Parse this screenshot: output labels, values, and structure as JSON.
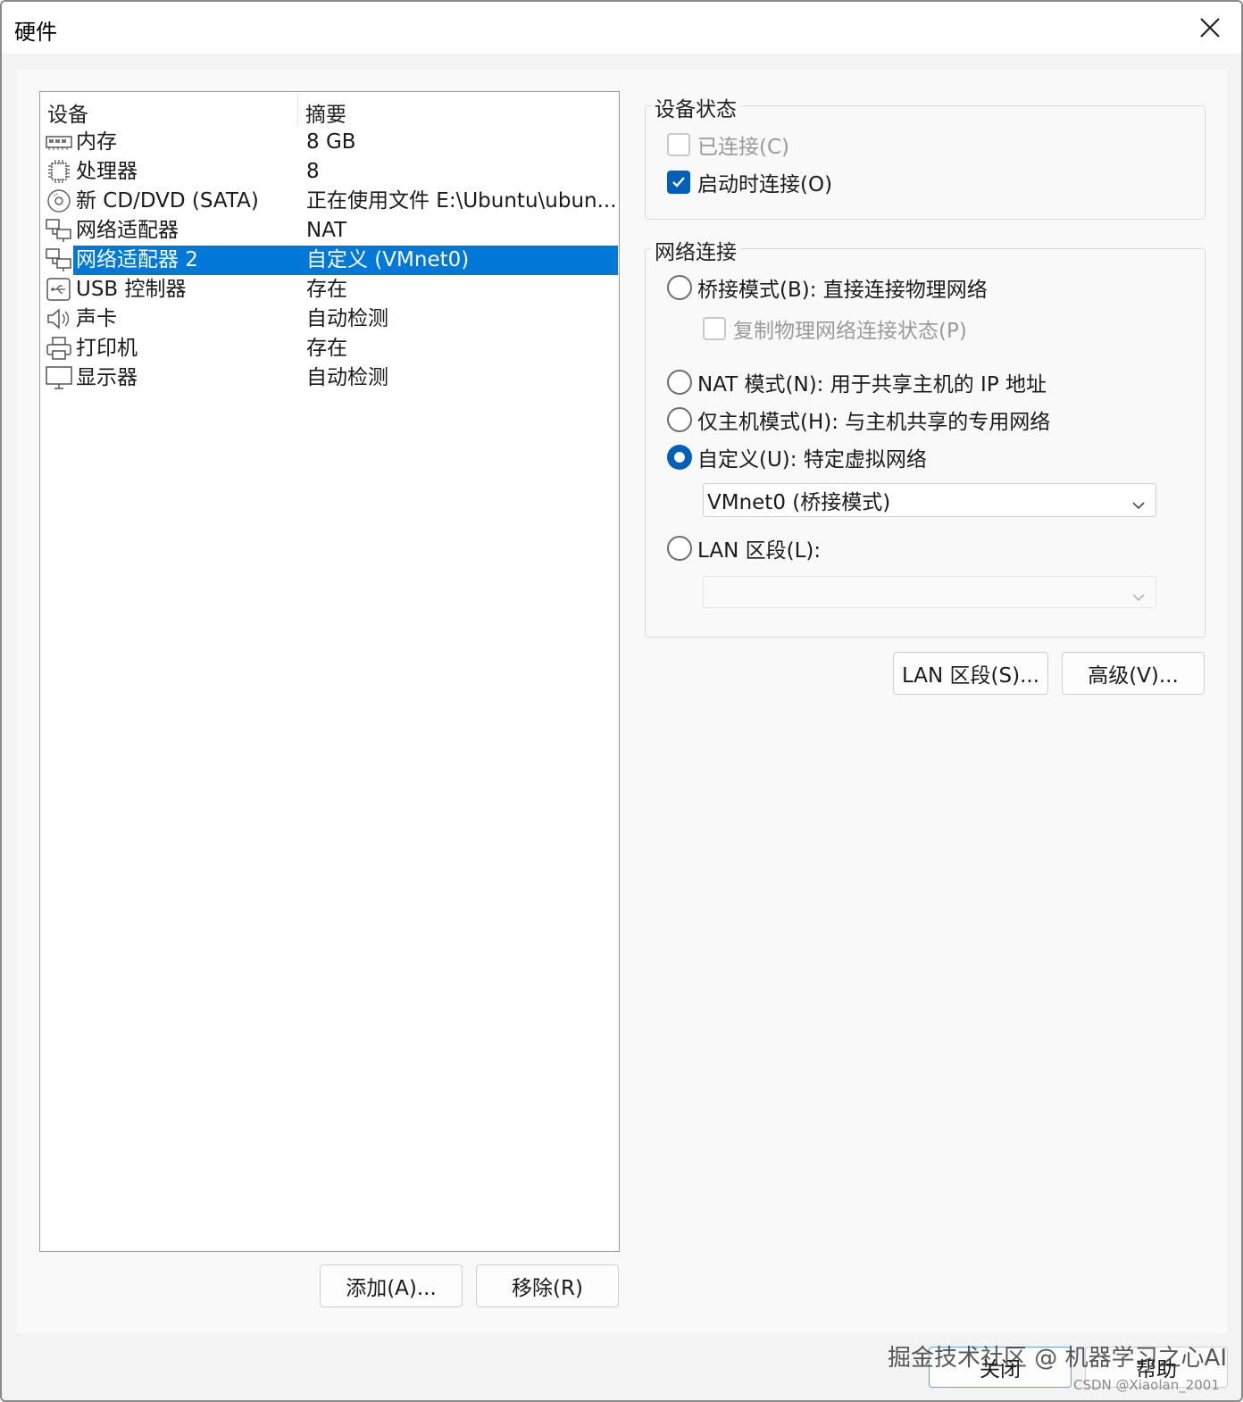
{
  "window": {
    "title": "硬件"
  },
  "device_list": {
    "columns": [
      "设备",
      "摘要"
    ],
    "rows": [
      {
        "icon": "memory-icon",
        "name": "内存",
        "summary": "8 GB"
      },
      {
        "icon": "processor-icon",
        "name": "处理器",
        "summary": "8"
      },
      {
        "icon": "cd-dvd-icon",
        "name": "新 CD/DVD (SATA)",
        "summary": "正在使用文件 E:\\Ubuntu\\ubun..."
      },
      {
        "icon": "network-adapter-icon",
        "name": "网络适配器",
        "summary": "NAT"
      },
      {
        "icon": "network-adapter-icon",
        "name": "网络适配器 2",
        "summary": "自定义 (VMnet0)",
        "selected": true
      },
      {
        "icon": "usb-icon",
        "name": "USB 控制器",
        "summary": "存在"
      },
      {
        "icon": "speaker-icon",
        "name": "声卡",
        "summary": "自动检测"
      },
      {
        "icon": "printer-icon",
        "name": "打印机",
        "summary": "存在"
      },
      {
        "icon": "monitor-icon",
        "name": "显示器",
        "summary": "自动检测"
      }
    ]
  },
  "left_buttons": {
    "add": "添加(A)...",
    "remove": "移除(R)"
  },
  "device_status": {
    "title": "设备状态",
    "connected": {
      "label": "已连接(C)",
      "checked": false,
      "disabled": true
    },
    "connect_on_start": {
      "label": "启动时连接(O)",
      "checked": true
    }
  },
  "network": {
    "title": "网络连接",
    "bridged": {
      "label": "桥接模式(B): 直接连接物理网络",
      "selected": false
    },
    "replicate": {
      "label": "复制物理网络连接状态(P)",
      "checked": false,
      "disabled": true
    },
    "nat": {
      "label": "NAT 模式(N): 用于共享主机的 IP 地址",
      "selected": false
    },
    "host_only": {
      "label": "仅主机模式(H): 与主机共享的专用网络",
      "selected": false
    },
    "custom": {
      "label": "自定义(U): 特定虚拟网络",
      "selected": true
    },
    "custom_select_value": "VMnet0 (桥接模式)",
    "lan": {
      "label": "LAN 区段(L):",
      "selected": false
    },
    "lan_select_value": ""
  },
  "right_buttons": {
    "lan_segments": "LAN 区段(S)...",
    "advanced": "高级(V)..."
  },
  "footer_buttons": {
    "close": "关闭",
    "help": "帮助"
  },
  "watermark": {
    "main": "掘金技术社区 @ 机器学习之心AI",
    "sub": "CSDN @Xiaolan_2001"
  },
  "colors": {
    "selection": "#0078d7",
    "accent": "#005fb8"
  }
}
